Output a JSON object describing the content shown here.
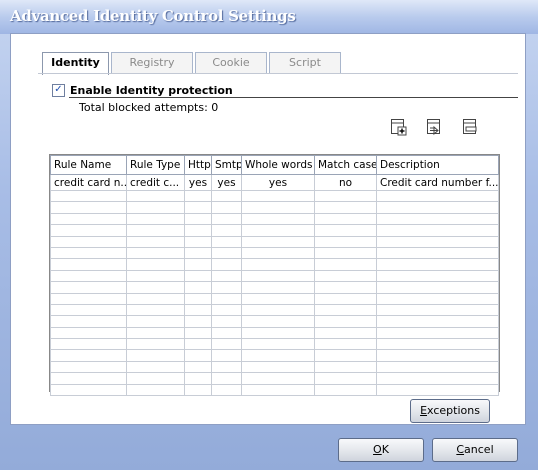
{
  "window": {
    "title": "Advanced Identity Control Settings"
  },
  "tabs": [
    {
      "label": "Identity",
      "active": true
    },
    {
      "label": "Registry",
      "active": false
    },
    {
      "label": "Cookie",
      "active": false
    },
    {
      "label": "Script",
      "active": false
    }
  ],
  "identity": {
    "enable_label": "Enable Identity protection",
    "enable_checked": true,
    "blocked_attempts": "Total blocked attempts: 0"
  },
  "toolbar": {
    "icons": [
      "add-rule-icon",
      "edit-rule-icon",
      "delete-rule-icon"
    ]
  },
  "rules_table": {
    "columns": [
      "Rule Name",
      "Rule Type",
      "Http",
      "Smtp",
      "Whole words",
      "Match case",
      "Description"
    ],
    "rows": [
      [
        "credit card n...",
        "credit c...",
        "yes",
        "yes",
        "yes",
        "no",
        "Credit card number f..."
      ]
    ]
  },
  "buttons": {
    "exceptions": {
      "mnemonic": "E",
      "rest": "xceptions"
    },
    "ok": {
      "mnemonic": "O",
      "rest": "K"
    },
    "cancel": {
      "mnemonic": "C",
      "rest": "ancel"
    }
  }
}
